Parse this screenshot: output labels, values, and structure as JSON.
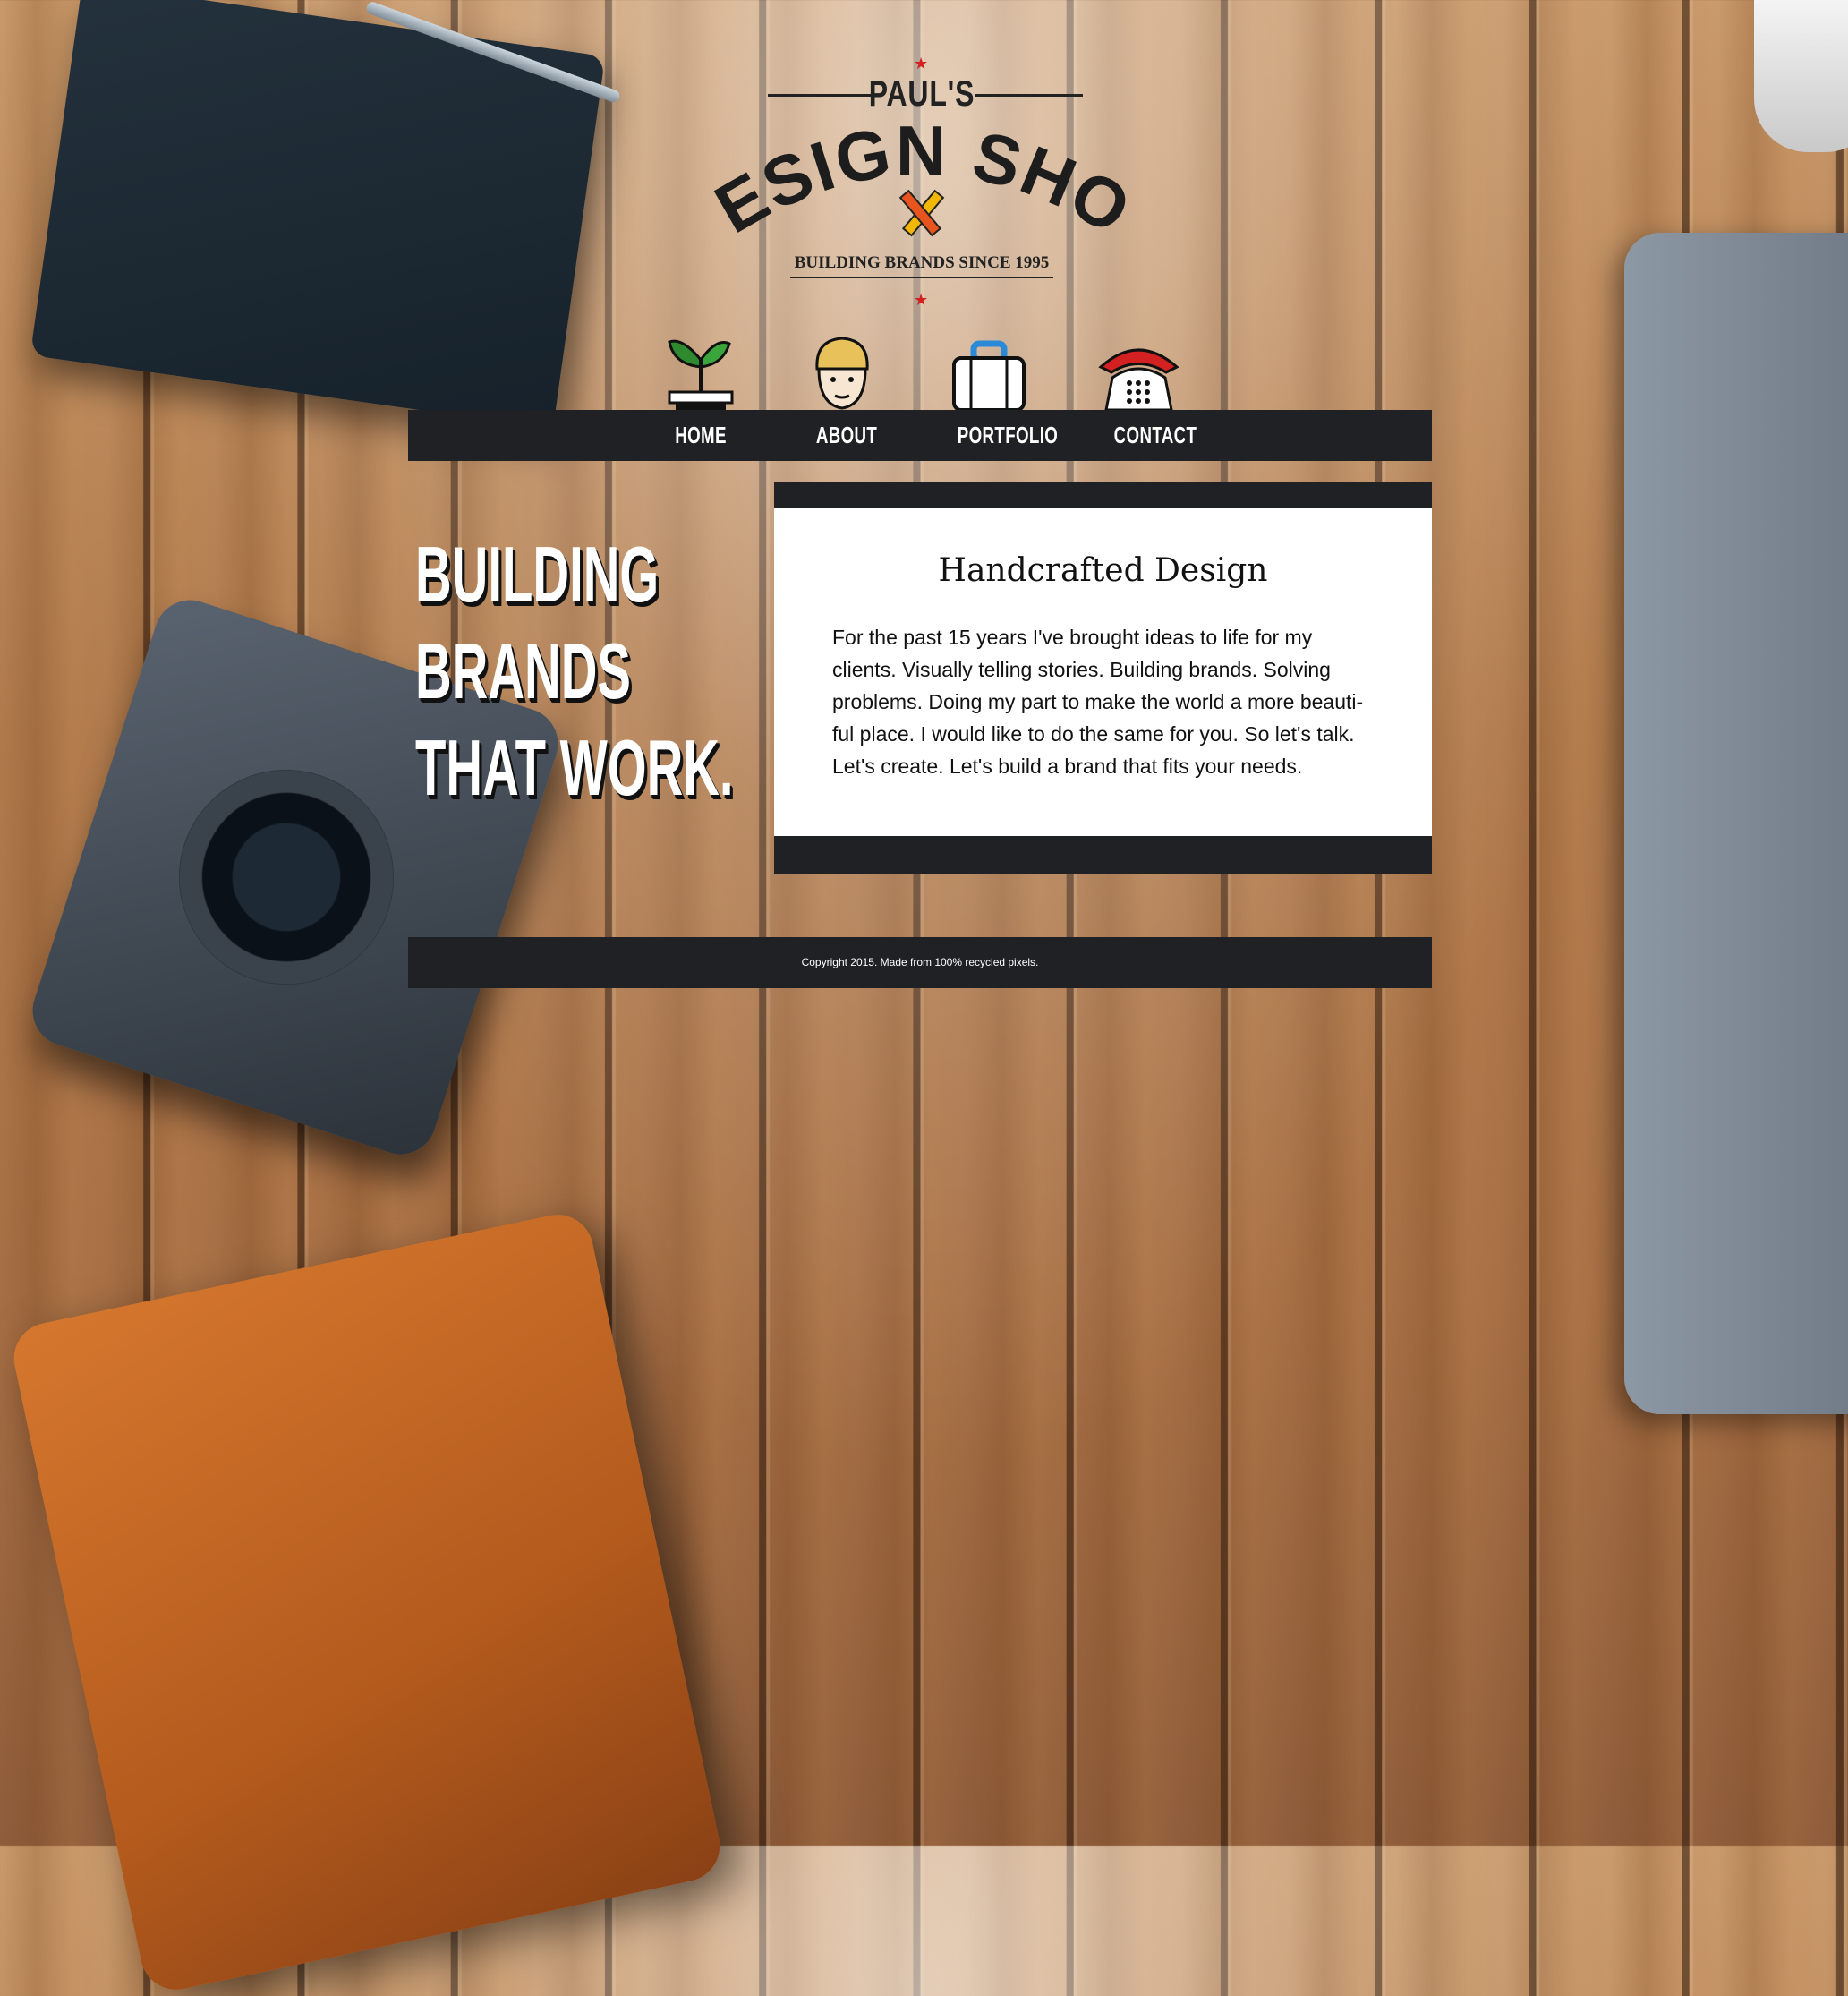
{
  "logo": {
    "pauls": "PAUL'S",
    "main": "DESIGN SHOP",
    "tagline": "BUILDING BRANDS SINCE 1995"
  },
  "nav": {
    "items": [
      {
        "label": "HOME",
        "icon": "plant-icon"
      },
      {
        "label": "ABOUT",
        "icon": "face-icon"
      },
      {
        "label": "PORTFOLIO",
        "icon": "briefcase-icon"
      },
      {
        "label": "CONTACT",
        "icon": "telephone-icon"
      }
    ]
  },
  "hero": {
    "lines": [
      "BUILDING",
      "BRANDS",
      "THAT WORK."
    ]
  },
  "card": {
    "title": "Handcrafted Design",
    "body_lines": [
      "For the past 15 years I've brought ideas to life for my",
      "clients. Visually telling stories. Building brands. Solving",
      "problems. Doing my part to make the world a more beauti-",
      "ful place. I would like to do the same for you. So let's talk.",
      "Let's create. Let's build a brand that fits your needs."
    ]
  },
  "footer": {
    "text": "Copyright 2015. Made from 100% recycled pixels."
  },
  "colors": {
    "bar": "#202124",
    "accent_red": "#d32020",
    "card_bg": "#ffffff"
  }
}
